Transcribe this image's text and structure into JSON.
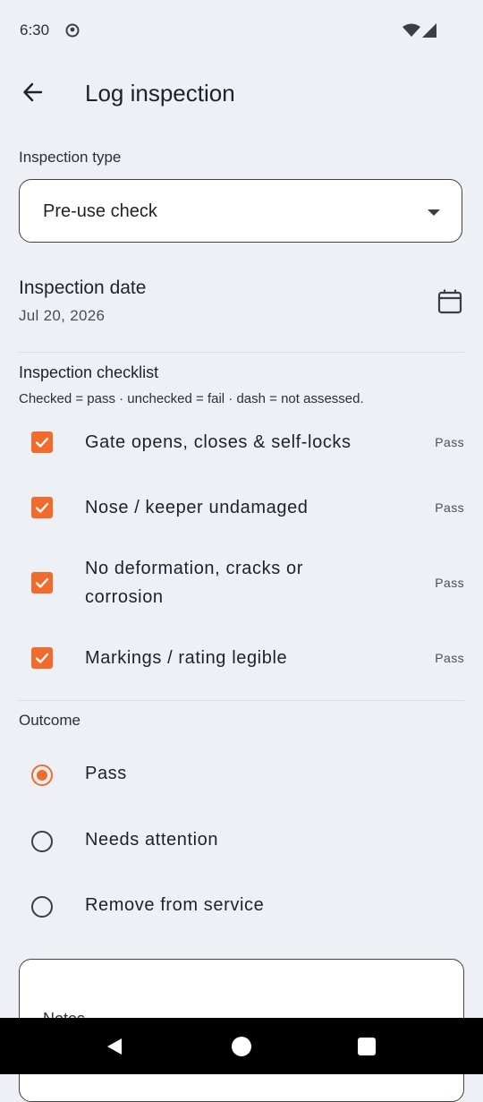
{
  "status_bar": {
    "time": "6:30",
    "icons": [
      "alert-icon",
      "wifi-icon",
      "signal-icon"
    ]
  },
  "app_bar": {
    "title": "Log inspection",
    "back_icon": "arrow-left-icon"
  },
  "inspection_type": {
    "label": "Inspection type",
    "value": "Pre-use check"
  },
  "inspection_date": {
    "title": "Inspection date",
    "value": "Jul 20, 2026",
    "icon": "calendar-icon"
  },
  "checklist": {
    "title": "Inspection checklist",
    "subtitle": "Checked = pass · unchecked = fail · dash = not assessed.",
    "items": [
      {
        "label": "Gate opens, closes & self-locks",
        "status": "Pass",
        "checked": true
      },
      {
        "label": "Nose / keeper undamaged",
        "status": "Pass",
        "checked": true
      },
      {
        "label": "No deformation, cracks or corrosion",
        "status": "Pass",
        "checked": true
      },
      {
        "label": "Markings / rating legible",
        "status": "Pass",
        "checked": true
      }
    ]
  },
  "outcome": {
    "title": "Outcome",
    "options": [
      {
        "label": "Pass",
        "selected": true
      },
      {
        "label": "Needs attention",
        "selected": false
      },
      {
        "label": "Remove from service",
        "selected": false
      }
    ]
  },
  "notes": {
    "placeholder": "Notes"
  },
  "nav_bar": {
    "buttons": [
      "back-triangle-icon",
      "home-circle-icon",
      "recents-square-icon"
    ]
  },
  "colors": {
    "accent": "#f26b2b",
    "background": "#edf1f5",
    "field": "#ffffff"
  }
}
